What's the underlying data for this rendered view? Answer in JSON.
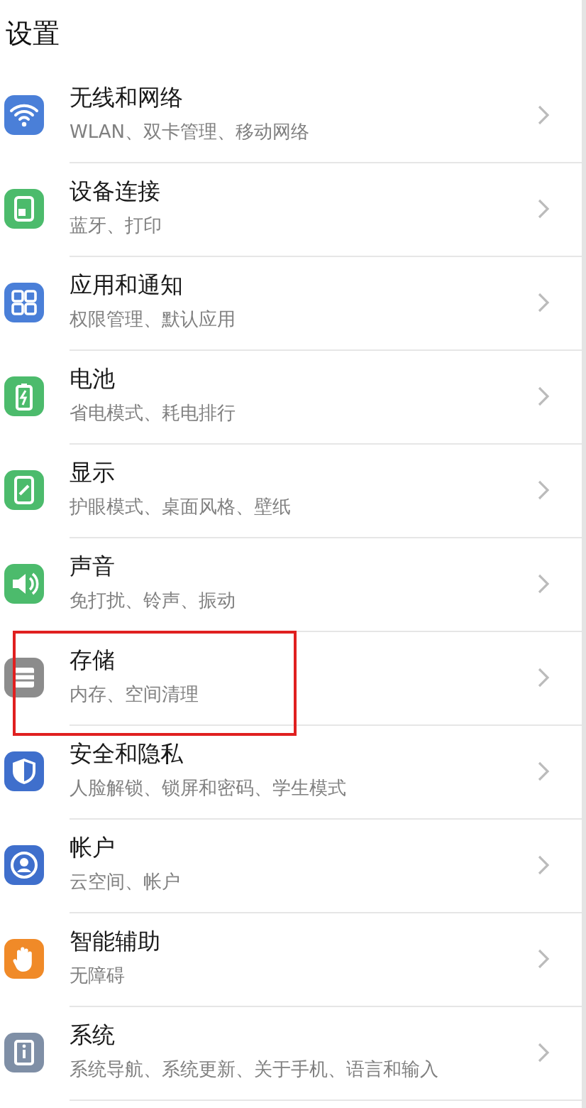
{
  "header": {
    "title": "设置"
  },
  "items": [
    {
      "title": "无线和网络",
      "subtitle": "WLAN、双卡管理、移动网络",
      "kind": "wifi",
      "color": "#4a7fd8",
      "highlighted": false
    },
    {
      "title": "设备连接",
      "subtitle": "蓝牙、打印",
      "kind": "device",
      "color": "#4cbb6c",
      "highlighted": false
    },
    {
      "title": "应用和通知",
      "subtitle": "权限管理、默认应用",
      "kind": "apps",
      "color": "#4a7fd8",
      "highlighted": false
    },
    {
      "title": "电池",
      "subtitle": "省电模式、耗电排行",
      "kind": "battery",
      "color": "#4cbb6c",
      "highlighted": false
    },
    {
      "title": "显示",
      "subtitle": "护眼模式、桌面风格、壁纸",
      "kind": "display",
      "color": "#4cbb6c",
      "highlighted": false
    },
    {
      "title": "声音",
      "subtitle": "免打扰、铃声、振动",
      "kind": "sound",
      "color": "#4cbb6c",
      "highlighted": false
    },
    {
      "title": "存储",
      "subtitle": "内存、空间清理",
      "kind": "storage",
      "color": "#8c8c8c",
      "highlighted": true
    },
    {
      "title": "安全和隐私",
      "subtitle": "人脸解锁、锁屏和密码、学生模式",
      "kind": "shield",
      "color": "#3f6fcc",
      "highlighted": false
    },
    {
      "title": "帐户",
      "subtitle": "云空间、帐户",
      "kind": "account",
      "color": "#3f6fcc",
      "highlighted": false
    },
    {
      "title": "智能辅助",
      "subtitle": "无障碍",
      "kind": "hand",
      "color": "#f08a28",
      "highlighted": false
    },
    {
      "title": "系统",
      "subtitle": "系统导航、系统更新、关于手机、语言和输入",
      "kind": "system",
      "color": "#7f8fa6",
      "highlighted": false
    }
  ]
}
